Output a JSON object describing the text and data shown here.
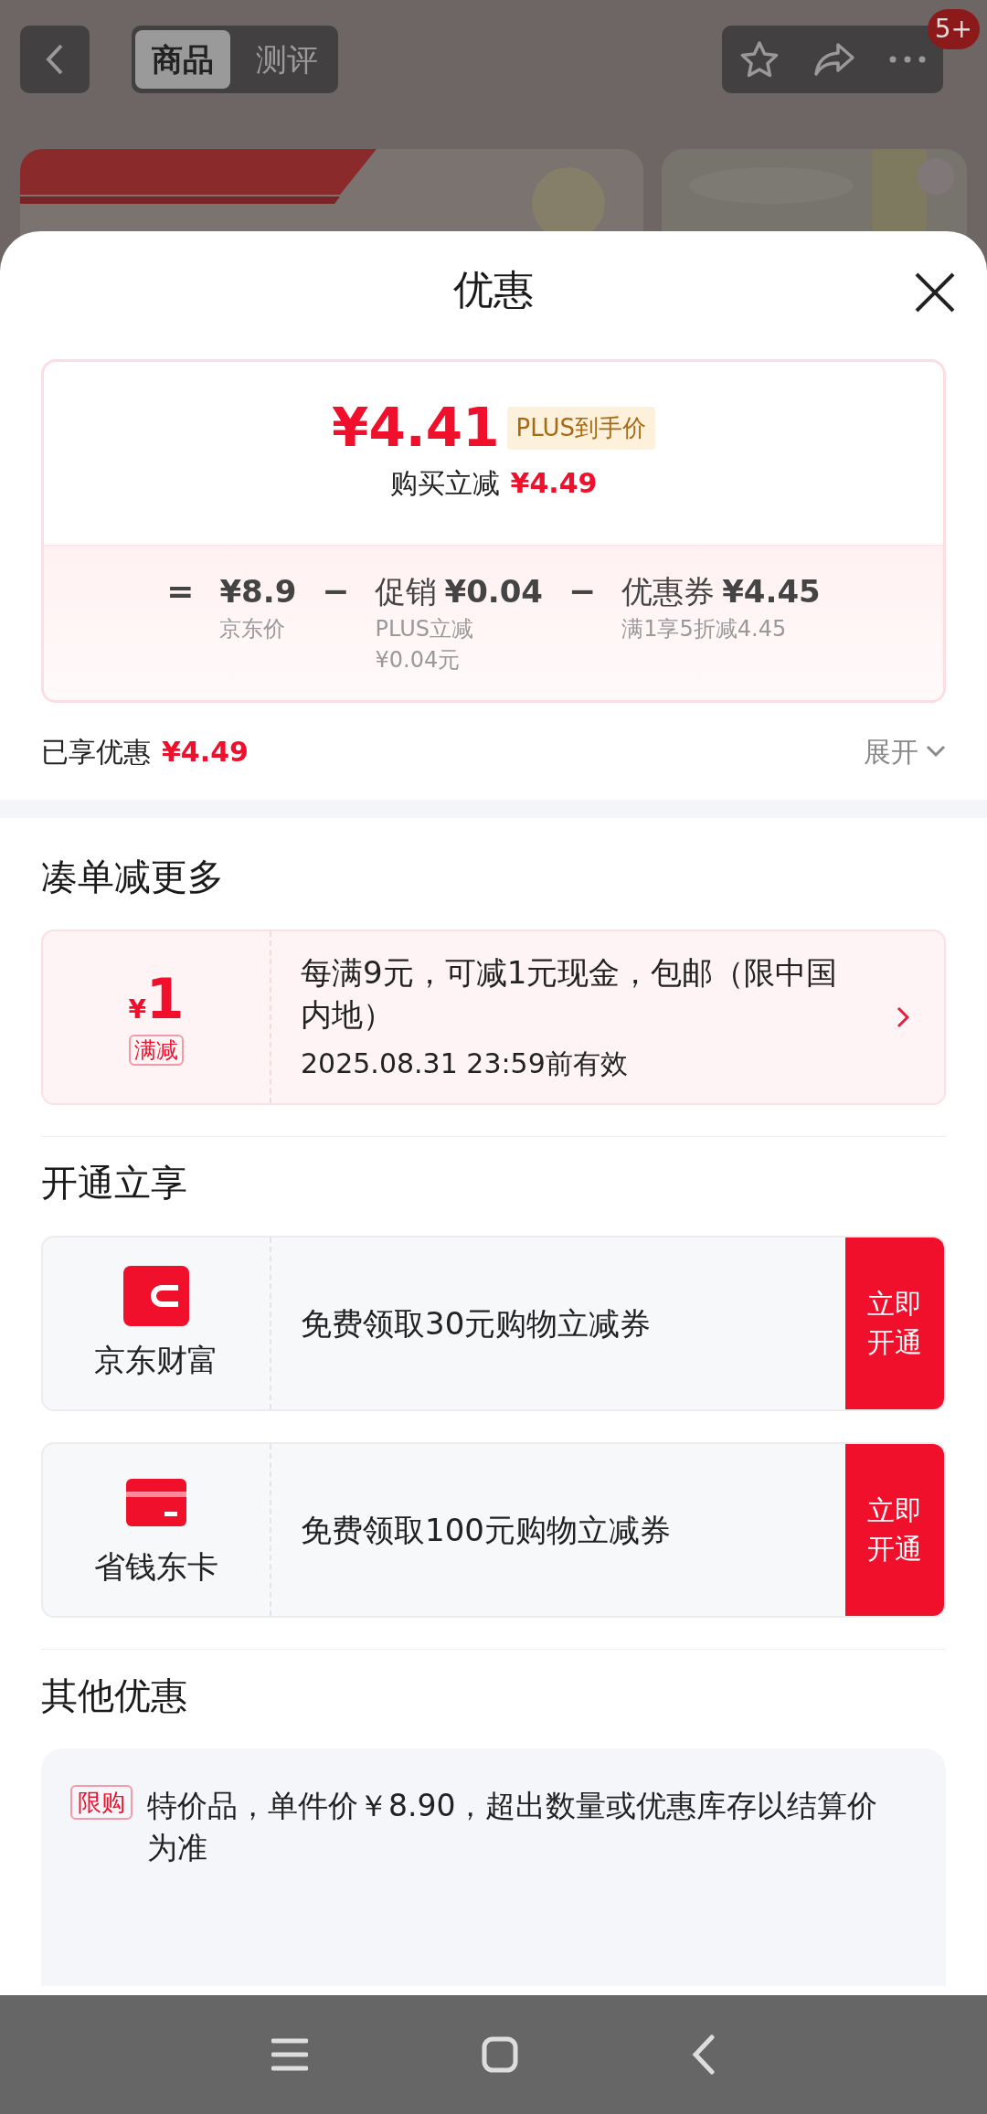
{
  "top_bar": {
    "tabs": [
      {
        "label": "商品",
        "selected": true
      },
      {
        "label": "测评",
        "selected": false
      }
    ],
    "badge": "5+"
  },
  "sheet": {
    "title": "优惠",
    "price_card": {
      "final_price": "¥4.41",
      "price_tag": "PLUS到手价",
      "reduction_label": "购买立减",
      "reduction": "¥4.49",
      "formula": [
        {
          "operator": "=",
          "amount": "¥8.9",
          "notes": [
            "京东价"
          ]
        },
        {
          "operator": "−",
          "name": "促销",
          "amount": "¥0.04",
          "notes": [
            "PLUS立减",
            "¥0.04元"
          ]
        },
        {
          "operator": "−",
          "name": "优惠券",
          "amount": "¥4.45",
          "notes": [
            "满1享5折减4.45"
          ]
        }
      ]
    },
    "enjoyed": {
      "label": "已享优惠",
      "amount": "¥4.49",
      "toggle": "展开"
    },
    "sections": [
      {
        "title": "凑单减更多",
        "kind": "coupon",
        "items": [
          {
            "currency": "¥",
            "value": "1",
            "tag": "满减",
            "text": "每满9元，可减1元现金，包邮（限中国内地）",
            "validity": "2025.08.31 23:59前有效"
          }
        ]
      },
      {
        "title": "开通立享",
        "kind": "offer",
        "items": [
          {
            "name": "京东财富",
            "text": "免费领取30元购物立减券",
            "button": "立即开通"
          },
          {
            "name": "省钱东卡",
            "text": "免费领取100元购物立减券",
            "button": "立即开通"
          }
        ]
      },
      {
        "title": "其他优惠",
        "kind": "notice",
        "items": [
          {
            "tag": "限购",
            "text": "特价品，单件价￥8.90，超出数量或优惠库存以结算价为准"
          }
        ]
      }
    ]
  }
}
